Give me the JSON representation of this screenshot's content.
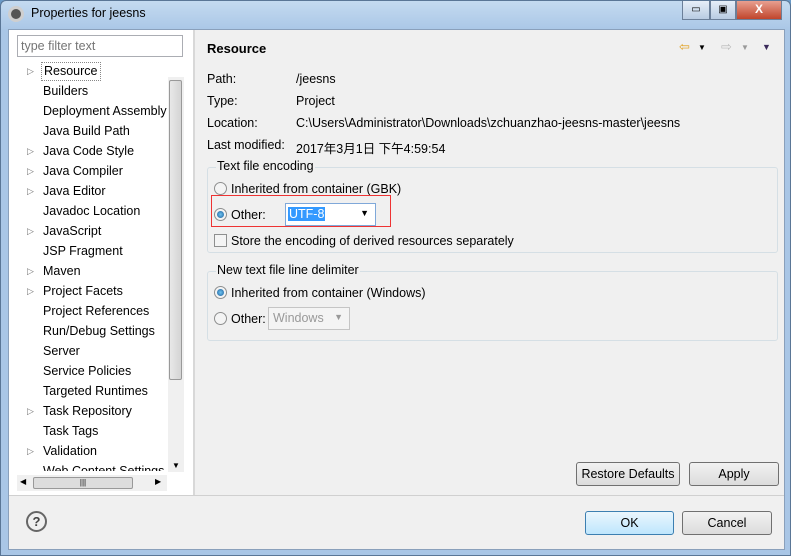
{
  "window": {
    "title": "Properties for jeesns",
    "minimize": "▭",
    "maximize": "▣",
    "close": "X"
  },
  "filter": {
    "placeholder": "type filter text"
  },
  "tree": [
    {
      "label": "Resource",
      "expandable": true,
      "selected": true
    },
    {
      "label": "Builders",
      "expandable": false
    },
    {
      "label": "Deployment Assembly",
      "expandable": false
    },
    {
      "label": "Java Build Path",
      "expandable": false
    },
    {
      "label": "Java Code Style",
      "expandable": true
    },
    {
      "label": "Java Compiler",
      "expandable": true
    },
    {
      "label": "Java Editor",
      "expandable": true
    },
    {
      "label": "Javadoc Location",
      "expandable": false
    },
    {
      "label": "JavaScript",
      "expandable": true
    },
    {
      "label": "JSP Fragment",
      "expandable": false
    },
    {
      "label": "Maven",
      "expandable": true
    },
    {
      "label": "Project Facets",
      "expandable": true
    },
    {
      "label": "Project References",
      "expandable": false
    },
    {
      "label": "Run/Debug Settings",
      "expandable": false
    },
    {
      "label": "Server",
      "expandable": false
    },
    {
      "label": "Service Policies",
      "expandable": false
    },
    {
      "label": "Targeted Runtimes",
      "expandable": false
    },
    {
      "label": "Task Repository",
      "expandable": true
    },
    {
      "label": "Task Tags",
      "expandable": false
    },
    {
      "label": "Validation",
      "expandable": true
    },
    {
      "label": "Web Content Settings",
      "expandable": false
    }
  ],
  "page": {
    "title": "Resource",
    "info": [
      {
        "key": "Path:",
        "value": "/jeesns"
      },
      {
        "key": "Type:",
        "value": "Project"
      },
      {
        "key": "Location:",
        "value": "C:\\Users\\Administrator\\Downloads\\zchuanzhao-jeesns-master\\jeesns"
      },
      {
        "key": "Last modified:",
        "value": "2017年3月1日 下午4:59:54"
      }
    ],
    "encoding": {
      "label": "Text file encoding",
      "inherited": "Inherited from container (GBK)",
      "other": "Other:",
      "value": "UTF-8",
      "store": "Store the encoding of derived resources separately",
      "selected": "other",
      "store_checked": false
    },
    "delimiter": {
      "label": "New text file line delimiter",
      "inherited": "Inherited from container (Windows)",
      "other": "Other:",
      "value": "Windows",
      "selected": "inherited"
    },
    "restore_defaults": "Restore Defaults",
    "apply": "Apply"
  },
  "footer": {
    "help": "?",
    "ok": "OK",
    "cancel": "Cancel"
  },
  "colors": {
    "accent": "#3399ff",
    "highlight_box": "#ee3333"
  }
}
